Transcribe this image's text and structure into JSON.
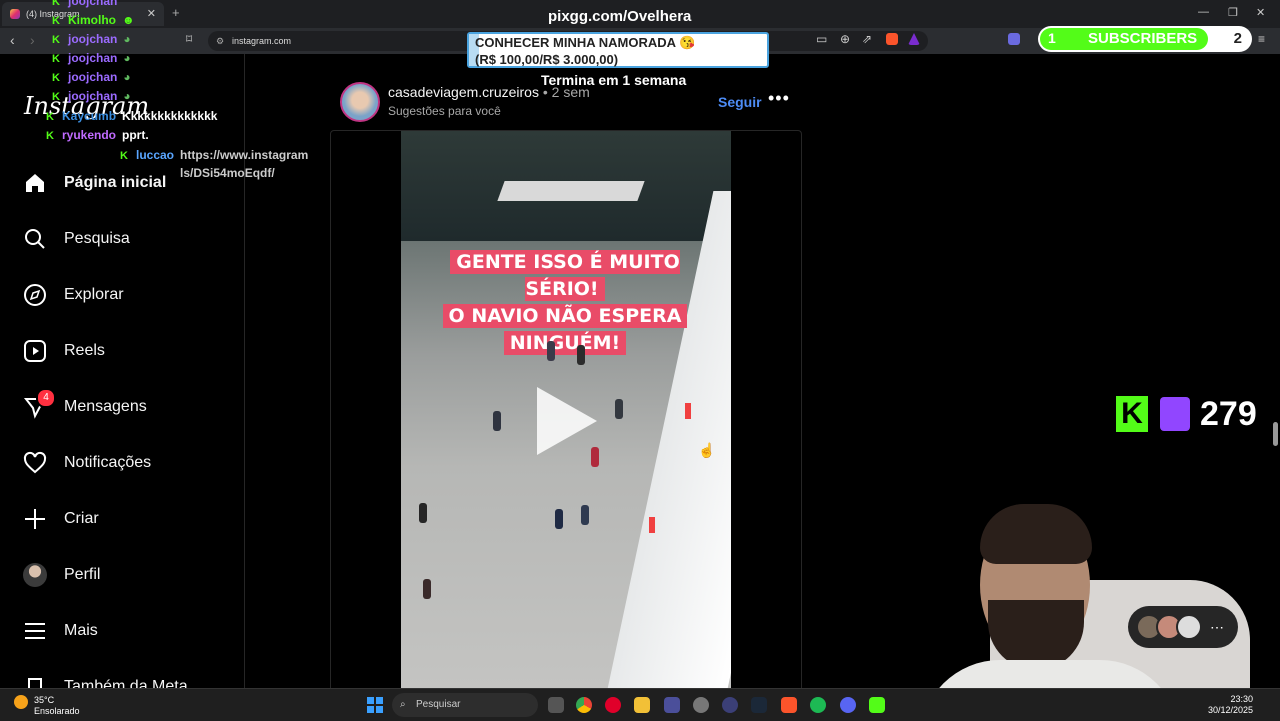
{
  "browser": {
    "tab_title": "(4) Instagram",
    "tab_close": "✕",
    "new_tab": "+",
    "url": "instagram.com",
    "window_controls": [
      "—",
      "❐",
      "✕"
    ]
  },
  "sidebar": {
    "logo": "Instagram",
    "items": [
      {
        "label": "Página inicial",
        "icon": "home-icon",
        "glyph": "⌂",
        "active": true
      },
      {
        "label": "Pesquisa",
        "icon": "search-icon",
        "glyph": "○"
      },
      {
        "label": "Explorar",
        "icon": "compass-icon",
        "glyph": "◎"
      },
      {
        "label": "Reels",
        "icon": "reels-icon",
        "glyph": "▷"
      },
      {
        "label": "Mensagens",
        "icon": "messenger-icon",
        "glyph": "✈",
        "badge": "4"
      },
      {
        "label": "Notificações",
        "icon": "heart-icon",
        "glyph": "♡"
      },
      {
        "label": "Criar",
        "icon": "plus-icon",
        "glyph": "+"
      },
      {
        "label": "Perfil",
        "icon": "avatar-icon"
      },
      {
        "label": "Mais",
        "icon": "menu-icon",
        "glyph": "≡"
      },
      {
        "label": "Também da Meta",
        "icon": "meta-icon",
        "glyph": "⌂"
      }
    ]
  },
  "post": {
    "username": "casadeviagem.cruzeiros",
    "time": " • 2 sem",
    "subtitle": "Sugestões para você",
    "follow": "Seguir",
    "more": "•••",
    "caption_lines": [
      "GENTE ISSO É MUITO SÉRIO!",
      "O NAVIO NÃO ESPERA",
      "NINGUÉM!"
    ]
  },
  "overlay": {
    "pix_title": "pixgg.com/Ovelhera",
    "goal_text_1": "CONHECER MINHA NAMORADA 😘",
    "goal_text_2": "(R$ 100,00/R$ 3.000,00)",
    "goal_progress": 0.033,
    "termina": "Termina em 1 semana",
    "subs_number": "1",
    "subs_label": "SUBSCRIBERS",
    "subs_goal": "2",
    "viewer_count": "279",
    "chat": [
      {
        "name": "joojchan",
        "msg": "",
        "color": "#9b6bff"
      },
      {
        "name": "Kimolho",
        "msg": "",
        "color": "#53fc18"
      },
      {
        "name": "joojchan",
        "msg": "",
        "color": "#9b6bff"
      },
      {
        "name": "joojchan",
        "msg": "",
        "color": "#9b6bff"
      },
      {
        "name": "joojchan",
        "msg": "",
        "color": "#9b6bff"
      },
      {
        "name": "joojchan",
        "msg": "",
        "color": "#9b6bff"
      },
      {
        "name": "Kaycumb",
        "msg": "Kkkkkkkkkkkkkk",
        "color": "#3b8fe0"
      },
      {
        "name": "ryukendo",
        "msg": "pprt.",
        "color": "#c06bff"
      },
      {
        "name": "luccao",
        "msg": "https://www.instagram",
        "color": "#5aa6ff"
      }
    ],
    "chat_wrap": "ls/DSi54moEqdf/"
  },
  "taskbar": {
    "temp": "35°C",
    "weather": "Ensolarado",
    "search": "Pesquisar",
    "time": "23:30",
    "date": "30/12/2025"
  },
  "colors": {
    "kick_green": "#53fc18",
    "instagram_blue": "#4d8cf5",
    "caption_bg": "#e94c68",
    "twitch_purple": "#9146ff"
  }
}
